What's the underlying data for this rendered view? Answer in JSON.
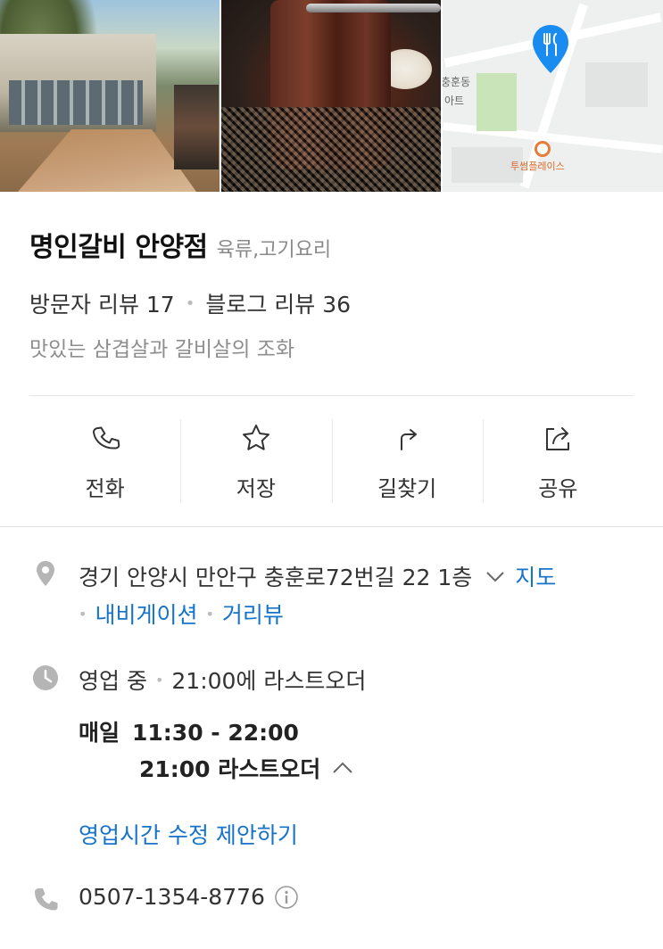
{
  "photos": {
    "items": [
      {
        "name": "storefront-photo"
      },
      {
        "name": "food-photo"
      },
      {
        "name": "map-thumbnail"
      }
    ],
    "map_labels": {
      "area": "충훈동",
      "area_line2": "아트",
      "poi": "투썸플레이스"
    }
  },
  "place": {
    "name": "명인갈비 안양점",
    "category": "육류,고기요리",
    "visitor_reviews": "방문자 리뷰 17",
    "blog_reviews": "블로그 리뷰 36",
    "tagline": "맛있는 삼겹살과 갈비살의 조화"
  },
  "actions": [
    {
      "label": "전화",
      "icon": "phone-icon"
    },
    {
      "label": "저장",
      "icon": "star-icon"
    },
    {
      "label": "길찾기",
      "icon": "directions-icon"
    },
    {
      "label": "공유",
      "icon": "share-icon"
    }
  ],
  "address": {
    "text": "경기 안양시 만안구 충훈로72번길 22 1층",
    "map_link": "지도",
    "navigation_link": "내비게이션",
    "street_view_link": "거리뷰"
  },
  "hours": {
    "status": "영업 중",
    "last_order_note": "21:00에 라스트오더",
    "day": "매일",
    "time": "11:30 - 22:00",
    "last_order": "21:00 라스트오더",
    "suggest_edit": "영업시간 수정 제안하기"
  },
  "phone": {
    "number": "0507-1354-8776"
  },
  "colors": {
    "link": "#1673c9",
    "map_pin": "#1a8cf0",
    "icon_gray": "#b5b5b5"
  }
}
